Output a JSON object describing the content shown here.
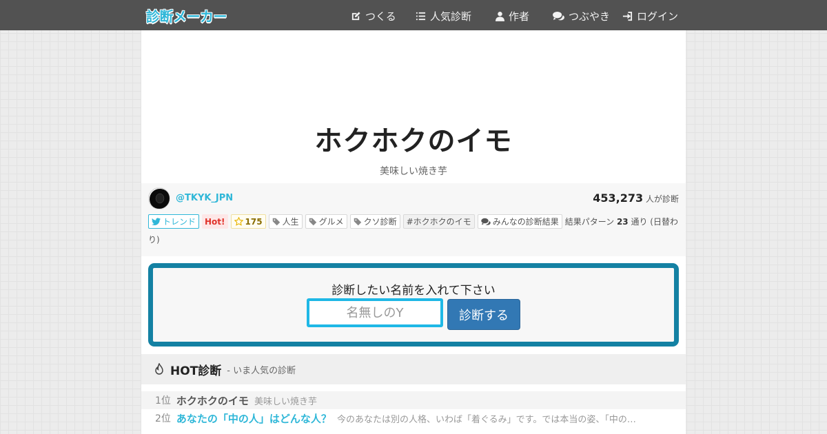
{
  "navbar": {
    "logo": "診断メーカー",
    "items": [
      {
        "label": "つくる",
        "icon": "edit-icon"
      },
      {
        "label": "人気診断",
        "icon": "list-icon"
      },
      {
        "label": "作者",
        "icon": "user-icon"
      },
      {
        "label": "つぶやき",
        "icon": "comments-icon"
      },
      {
        "label": "ログイン",
        "icon": "login-icon"
      }
    ]
  },
  "diagnosis": {
    "title": "ホクホクのイモ",
    "subtitle": "美味しい焼き芋",
    "author": "@TKYK_JPN",
    "count": "453,273",
    "count_suffix": "人が診断"
  },
  "tags": {
    "trend": "トレンド",
    "hot": "Hot!",
    "stars": "175",
    "items": [
      "人生",
      "グルメ",
      "クソ診断"
    ],
    "hashtag": "#ホクホクのイモ",
    "results": "みんなの診断結果",
    "pattern_prefix": "結果パターン",
    "pattern_count": "23",
    "pattern_suffix": "通り (日替わ",
    "pattern_tail": "り)"
  },
  "form": {
    "label": "診断したい名前を入れて下さい",
    "placeholder": "名無しのY",
    "submit": "診断する"
  },
  "hot": {
    "title": "HOT診断",
    "subtitle": "- いま人気の診断",
    "ranks": [
      {
        "rank": "1位",
        "title": "ホクホクのイモ",
        "desc": "美味しい焼き芋"
      },
      {
        "rank": "2位",
        "title": "あなたの「中の人」はどんな人？",
        "desc": "今のあなたは別の人格、いわば「着ぐるみ」です。では本当の姿、「中の…"
      }
    ]
  },
  "colors": {
    "navbar_bg": "#525252",
    "accent": "#2fb7d8",
    "form_border": "#1481a3",
    "button": "#3278b4"
  }
}
